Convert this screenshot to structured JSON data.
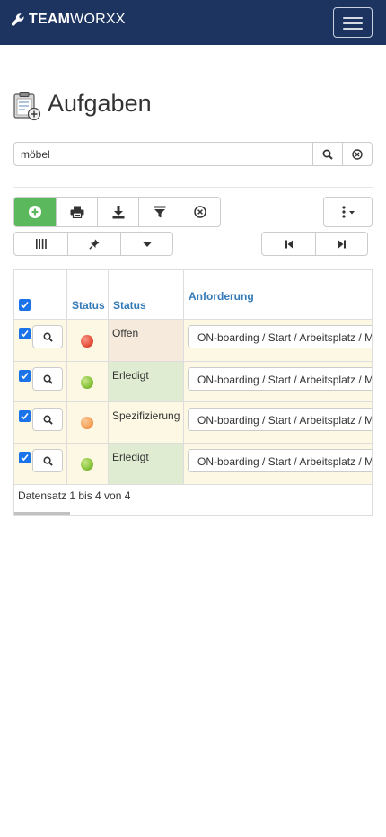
{
  "navbar": {
    "brand_bold": "TEAM",
    "brand_light": "WORXX",
    "bg_color": "#1d3461"
  },
  "page": {
    "title": "Aufgaben"
  },
  "search": {
    "value": "möbel"
  },
  "table": {
    "headers": [
      "Status",
      "Status",
      "Anforderung"
    ],
    "rows": [
      {
        "status_color": "#e8533f",
        "status": "Offen",
        "anforderung": "ON-boarding / Start / Arbeitsplatz / M"
      },
      {
        "status_color": "#8cc63f",
        "status": "Erledigt",
        "anforderung": "ON-boarding / Start / Arbeitsplatz / M"
      },
      {
        "status_color": "#f7a35c",
        "status": "Spezifizierung",
        "anforderung": "ON-boarding / Start / Arbeitsplatz / M"
      },
      {
        "status_color": "#8cc63f",
        "status": "Erledigt",
        "anforderung": "ON-boarding / Start / Arbeitsplatz / M"
      }
    ],
    "footer": "Datensatz 1 bis 4 von 4"
  },
  "colors": {
    "accent_green": "#5cb85c",
    "link_blue": "#337ab7",
    "row_bg": "#fcf8e3"
  }
}
